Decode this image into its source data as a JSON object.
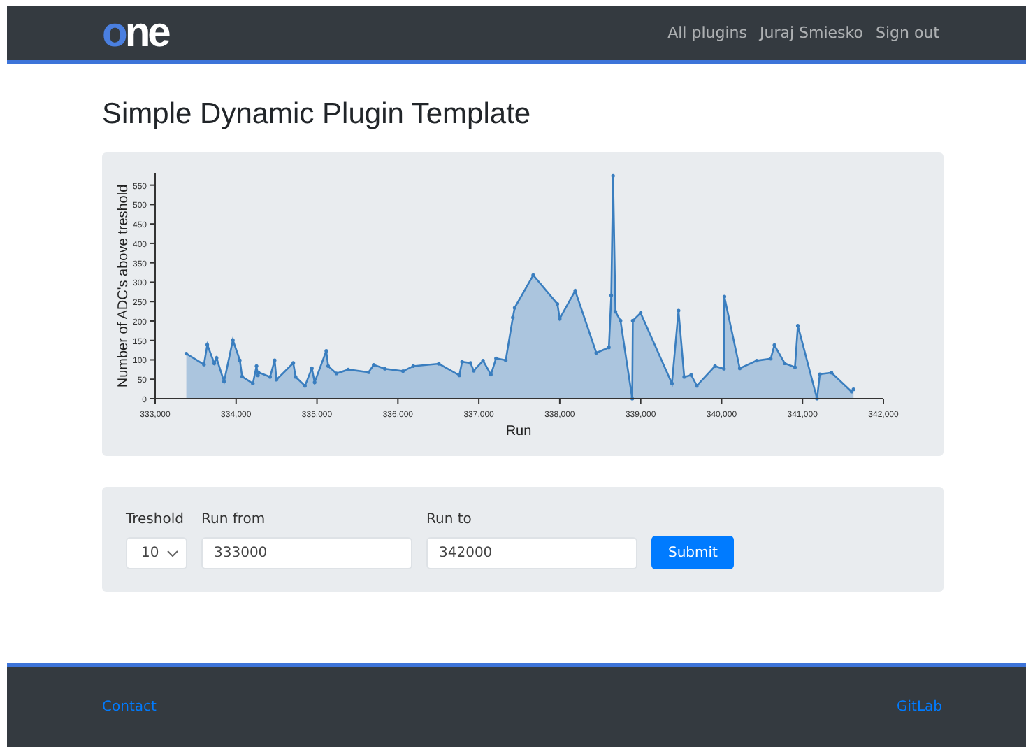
{
  "navbar": {
    "logo": "one",
    "links": [
      "All plugins",
      "Juraj Smiesko",
      "Sign out"
    ]
  },
  "title": "Simple Dynamic Plugin Template",
  "chart": {
    "chart_data": {
      "type": "area",
      "xlabel": "Run",
      "ylabel": "Number of ADC's above treshold",
      "xlim": [
        333000,
        342000
      ],
      "ylim": [
        0,
        580
      ],
      "xticks": [
        {
          "value": 333000,
          "label": "333,000"
        },
        {
          "value": 334000,
          "label": "334,000"
        },
        {
          "value": 335000,
          "label": "335,000"
        },
        {
          "value": 336000,
          "label": "336,000"
        },
        {
          "value": 337000,
          "label": "337,000"
        },
        {
          "value": 338000,
          "label": "338,000"
        },
        {
          "value": 339000,
          "label": "339,000"
        },
        {
          "value": 340000,
          "label": "340,000"
        },
        {
          "value": 341000,
          "label": "341,000"
        },
        {
          "value": 342000,
          "label": "342,000"
        }
      ],
      "yticks": [
        0,
        50,
        100,
        150,
        200,
        250,
        300,
        350,
        400,
        450,
        500,
        550
      ],
      "x": [
        333385,
        333603,
        333644,
        333730,
        333759,
        333851,
        333960,
        334046,
        334075,
        334207,
        334253,
        334270,
        334276,
        334420,
        334477,
        334500,
        334707,
        334736,
        334851,
        334937,
        334971,
        335115,
        335138,
        335241,
        335385,
        335638,
        335701,
        335839,
        336063,
        336190,
        336506,
        336759,
        336793,
        336897,
        336937,
        337052,
        337149,
        337213,
        337333,
        337420,
        337443,
        337672,
        337971,
        338000,
        338191,
        338451,
        338607,
        338636,
        338659,
        338688,
        338751,
        338896,
        338902,
        339000,
        339387,
        339468,
        339538,
        339624,
        339694,
        339919,
        340029,
        340035,
        340225,
        340434,
        340607,
        340653,
        340780,
        340907,
        340942,
        341179,
        341214,
        341358,
        341607,
        341630
      ],
      "series": [
        {
          "color": "#3a7ebf",
          "values": [
            116,
            88,
            139,
            91,
            105,
            44,
            151,
            99,
            57,
            39,
            84,
            60,
            68,
            56,
            99,
            49,
            92,
            56,
            33,
            78,
            42,
            123,
            84,
            65,
            75,
            68,
            87,
            77,
            71,
            84,
            90,
            60,
            95,
            92,
            72,
            98,
            62,
            104,
            99,
            209,
            234,
            318,
            244,
            206,
            278,
            118,
            132,
            266,
            574,
            224,
            201,
            0,
            201,
            221,
            39,
            227,
            56,
            61,
            33,
            84,
            77,
            263,
            78,
            98,
            103,
            138,
            91,
            81,
            188,
            0,
            63,
            67,
            18,
            24
          ]
        }
      ]
    }
  },
  "form": {
    "threshold": {
      "label": "Treshold",
      "value": "10"
    },
    "run_from": {
      "label": "Run from",
      "value": "333000"
    },
    "run_to": {
      "label": "Run to",
      "value": "342000"
    },
    "submit": "Submit"
  },
  "footer": {
    "links": [
      "Contact",
      "GitLab"
    ]
  }
}
